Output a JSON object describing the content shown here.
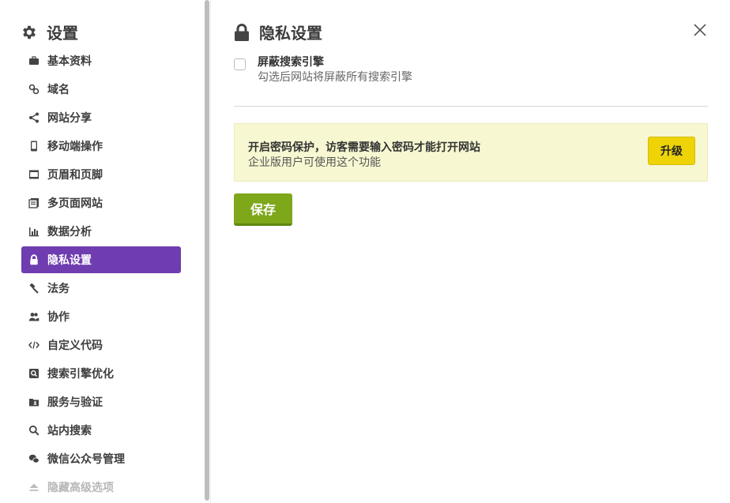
{
  "sidebar": {
    "title": "设置",
    "items": [
      {
        "label": "基本资料",
        "icon": "briefcase-icon"
      },
      {
        "label": "域名",
        "icon": "link-icon"
      },
      {
        "label": "网站分享",
        "icon": "share-icon"
      },
      {
        "label": "移动端操作",
        "icon": "mobile-icon"
      },
      {
        "label": "页眉和页脚",
        "icon": "header-footer-icon"
      },
      {
        "label": "多页面网站",
        "icon": "pages-icon"
      },
      {
        "label": "数据分析",
        "icon": "bar-chart-icon"
      },
      {
        "label": "隐私设置",
        "icon": "lock-icon",
        "active": true
      },
      {
        "label": "法务",
        "icon": "gavel-icon"
      },
      {
        "label": "协作",
        "icon": "users-icon"
      },
      {
        "label": "自定义代码",
        "icon": "code-icon"
      },
      {
        "label": "搜索引擎优化",
        "icon": "seo-search-icon"
      },
      {
        "label": "服务与验证",
        "icon": "folder-user-icon"
      },
      {
        "label": "站内搜索",
        "icon": "search-icon"
      },
      {
        "label": "微信公众号管理",
        "icon": "wechat-icon"
      },
      {
        "label": "隐藏高级选项",
        "icon": "eject-icon",
        "muted": true
      }
    ]
  },
  "main": {
    "title": "隐私设置",
    "option": {
      "title": "屏蔽搜索引擎",
      "description": "勾选后网站将屏蔽所有搜索引擎",
      "checked": false
    },
    "notice": {
      "title": "开启密码保护，访客需要输入密码才能打开网站",
      "description": "企业版用户可使用这个功能",
      "button_label": "升级"
    },
    "save_label": "保存"
  },
  "colors": {
    "active_item": "#6f3db0",
    "save_button": "#7ea81a",
    "upgrade_button": "#eed307",
    "notice_bg": "#f7f7d2"
  }
}
